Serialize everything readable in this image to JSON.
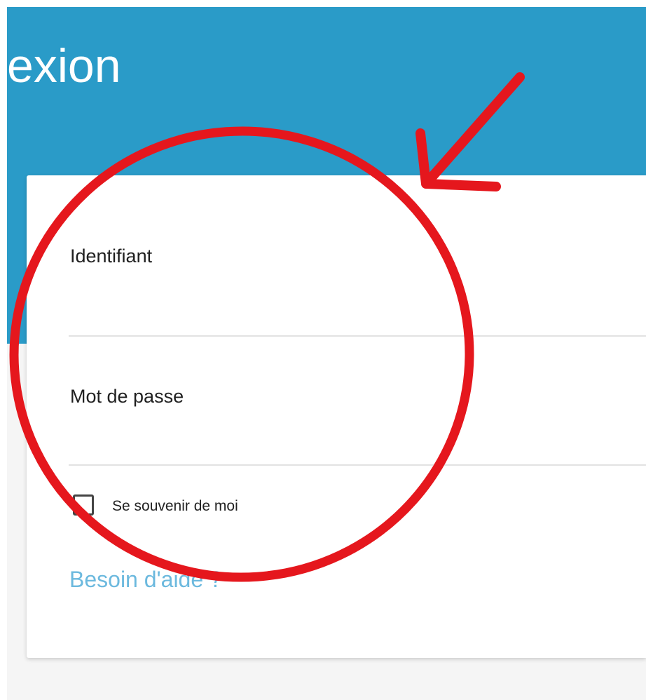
{
  "header": {
    "title": "exion",
    "background_color": "#2a9bc8"
  },
  "login_form": {
    "username_label": "Identifiant",
    "username_value": "",
    "password_label": "Mot de passe",
    "password_value": "",
    "remember_me_label": "Se souvenir de moi",
    "remember_me_checked": false,
    "help_link": "Besoin d'aide ?"
  },
  "colors": {
    "link": "#6cb9de",
    "annotation": "#e5171d"
  }
}
